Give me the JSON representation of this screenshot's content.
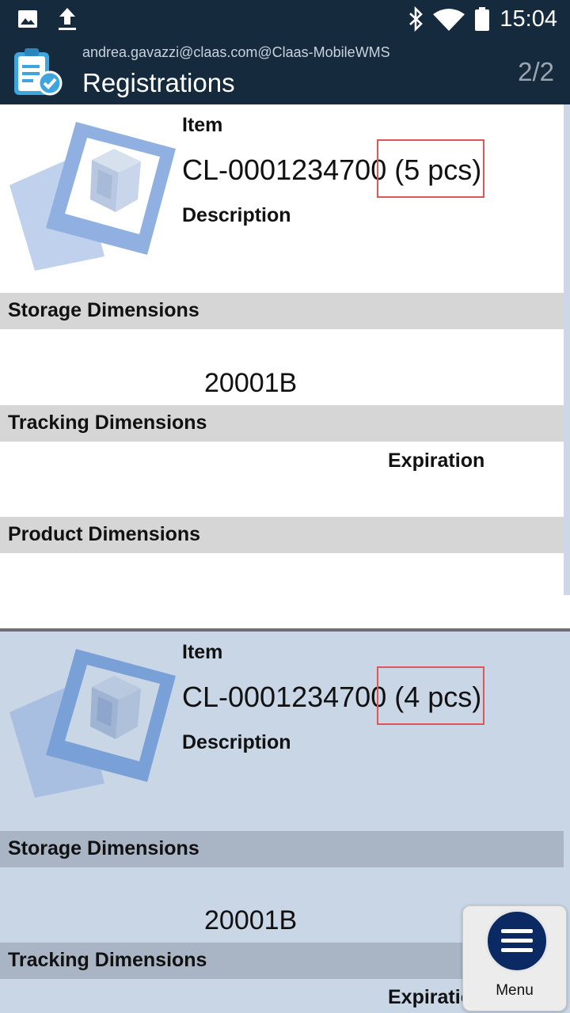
{
  "status_bar": {
    "time": "15:04",
    "icons": [
      "image-icon",
      "upload-icon",
      "bluetooth-icon",
      "wifi-icon",
      "battery-icon"
    ]
  },
  "app_bar": {
    "user": "andrea.gavazzi@claas.com@Claas-MobileWMS",
    "title": "Registrations",
    "page_indicator": "2/2",
    "icon": "clipboard-check-icon"
  },
  "registrations": [
    {
      "item_label": "Item",
      "item_code": "CL-0001234700",
      "quantity": "(5 pcs)",
      "description_label": "Description",
      "storage_header": "Storage Dimensions",
      "storage_value": "20001B",
      "tracking_header": "Tracking Dimensions",
      "expiration_label": "Expiration",
      "product_header": "Product Dimensions"
    },
    {
      "item_label": "Item",
      "item_code": "CL-0001234700",
      "quantity": "(4 pcs)",
      "description_label": "Description",
      "storage_header": "Storage Dimensions",
      "storage_value": "20001B",
      "tracking_header": "Tracking Dimensions",
      "expiration_label": "Expiration"
    }
  ],
  "menu": {
    "label": "Menu",
    "icon": "hamburger-icon"
  },
  "colors": {
    "app_bar": "#162a3d",
    "highlight": "#e05555",
    "selected_card": "#c9d6e6",
    "menu_button": "#0b2a63"
  }
}
